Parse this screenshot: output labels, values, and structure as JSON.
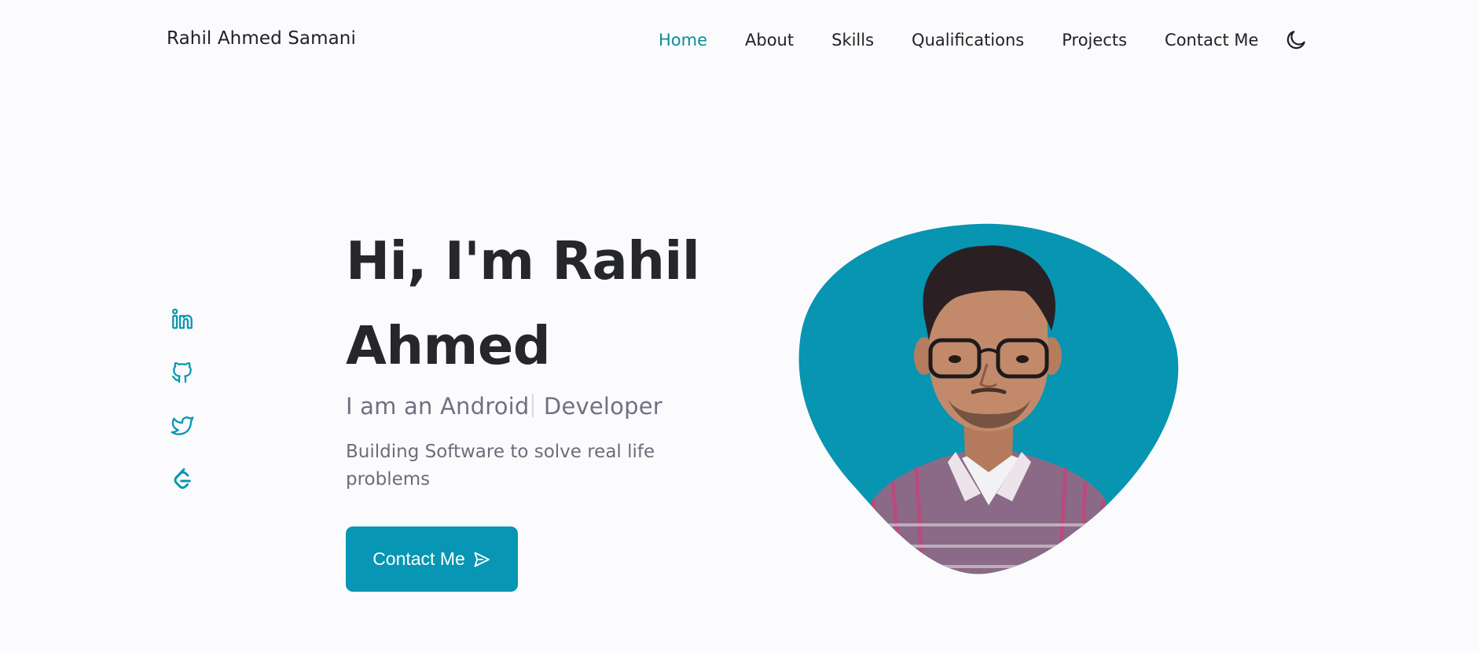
{
  "header": {
    "logo": "Rahil Ahmed Samani",
    "nav": [
      {
        "label": "Home",
        "active": true
      },
      {
        "label": "About",
        "active": false
      },
      {
        "label": "Skills",
        "active": false
      },
      {
        "label": "Qualifications",
        "active": false
      },
      {
        "label": "Projects",
        "active": false
      },
      {
        "label": "Contact Me",
        "active": false
      }
    ],
    "theme_toggle_icon": "moon-icon"
  },
  "social": [
    {
      "name": "linkedin",
      "icon": "linkedin-icon"
    },
    {
      "name": "github",
      "icon": "github-icon"
    },
    {
      "name": "twitter",
      "icon": "twitter-icon"
    },
    {
      "name": "leetcode",
      "icon": "leetcode-icon"
    }
  ],
  "hero": {
    "title_line1": "Hi, I'm Rahil",
    "title_line2": "Ahmed",
    "subtitle_prefix": "I am an Android",
    "subtitle_suffix": " Developer",
    "description": "Building Software to solve real life problems",
    "contact_button": "Contact Me",
    "contact_button_icon": "send-icon"
  },
  "colors": {
    "accent": "#0796b3",
    "nav_active": "#0a8d9e",
    "title": "#25272b",
    "text_muted": "#6b6d7a",
    "background": "#fbfbfd"
  }
}
